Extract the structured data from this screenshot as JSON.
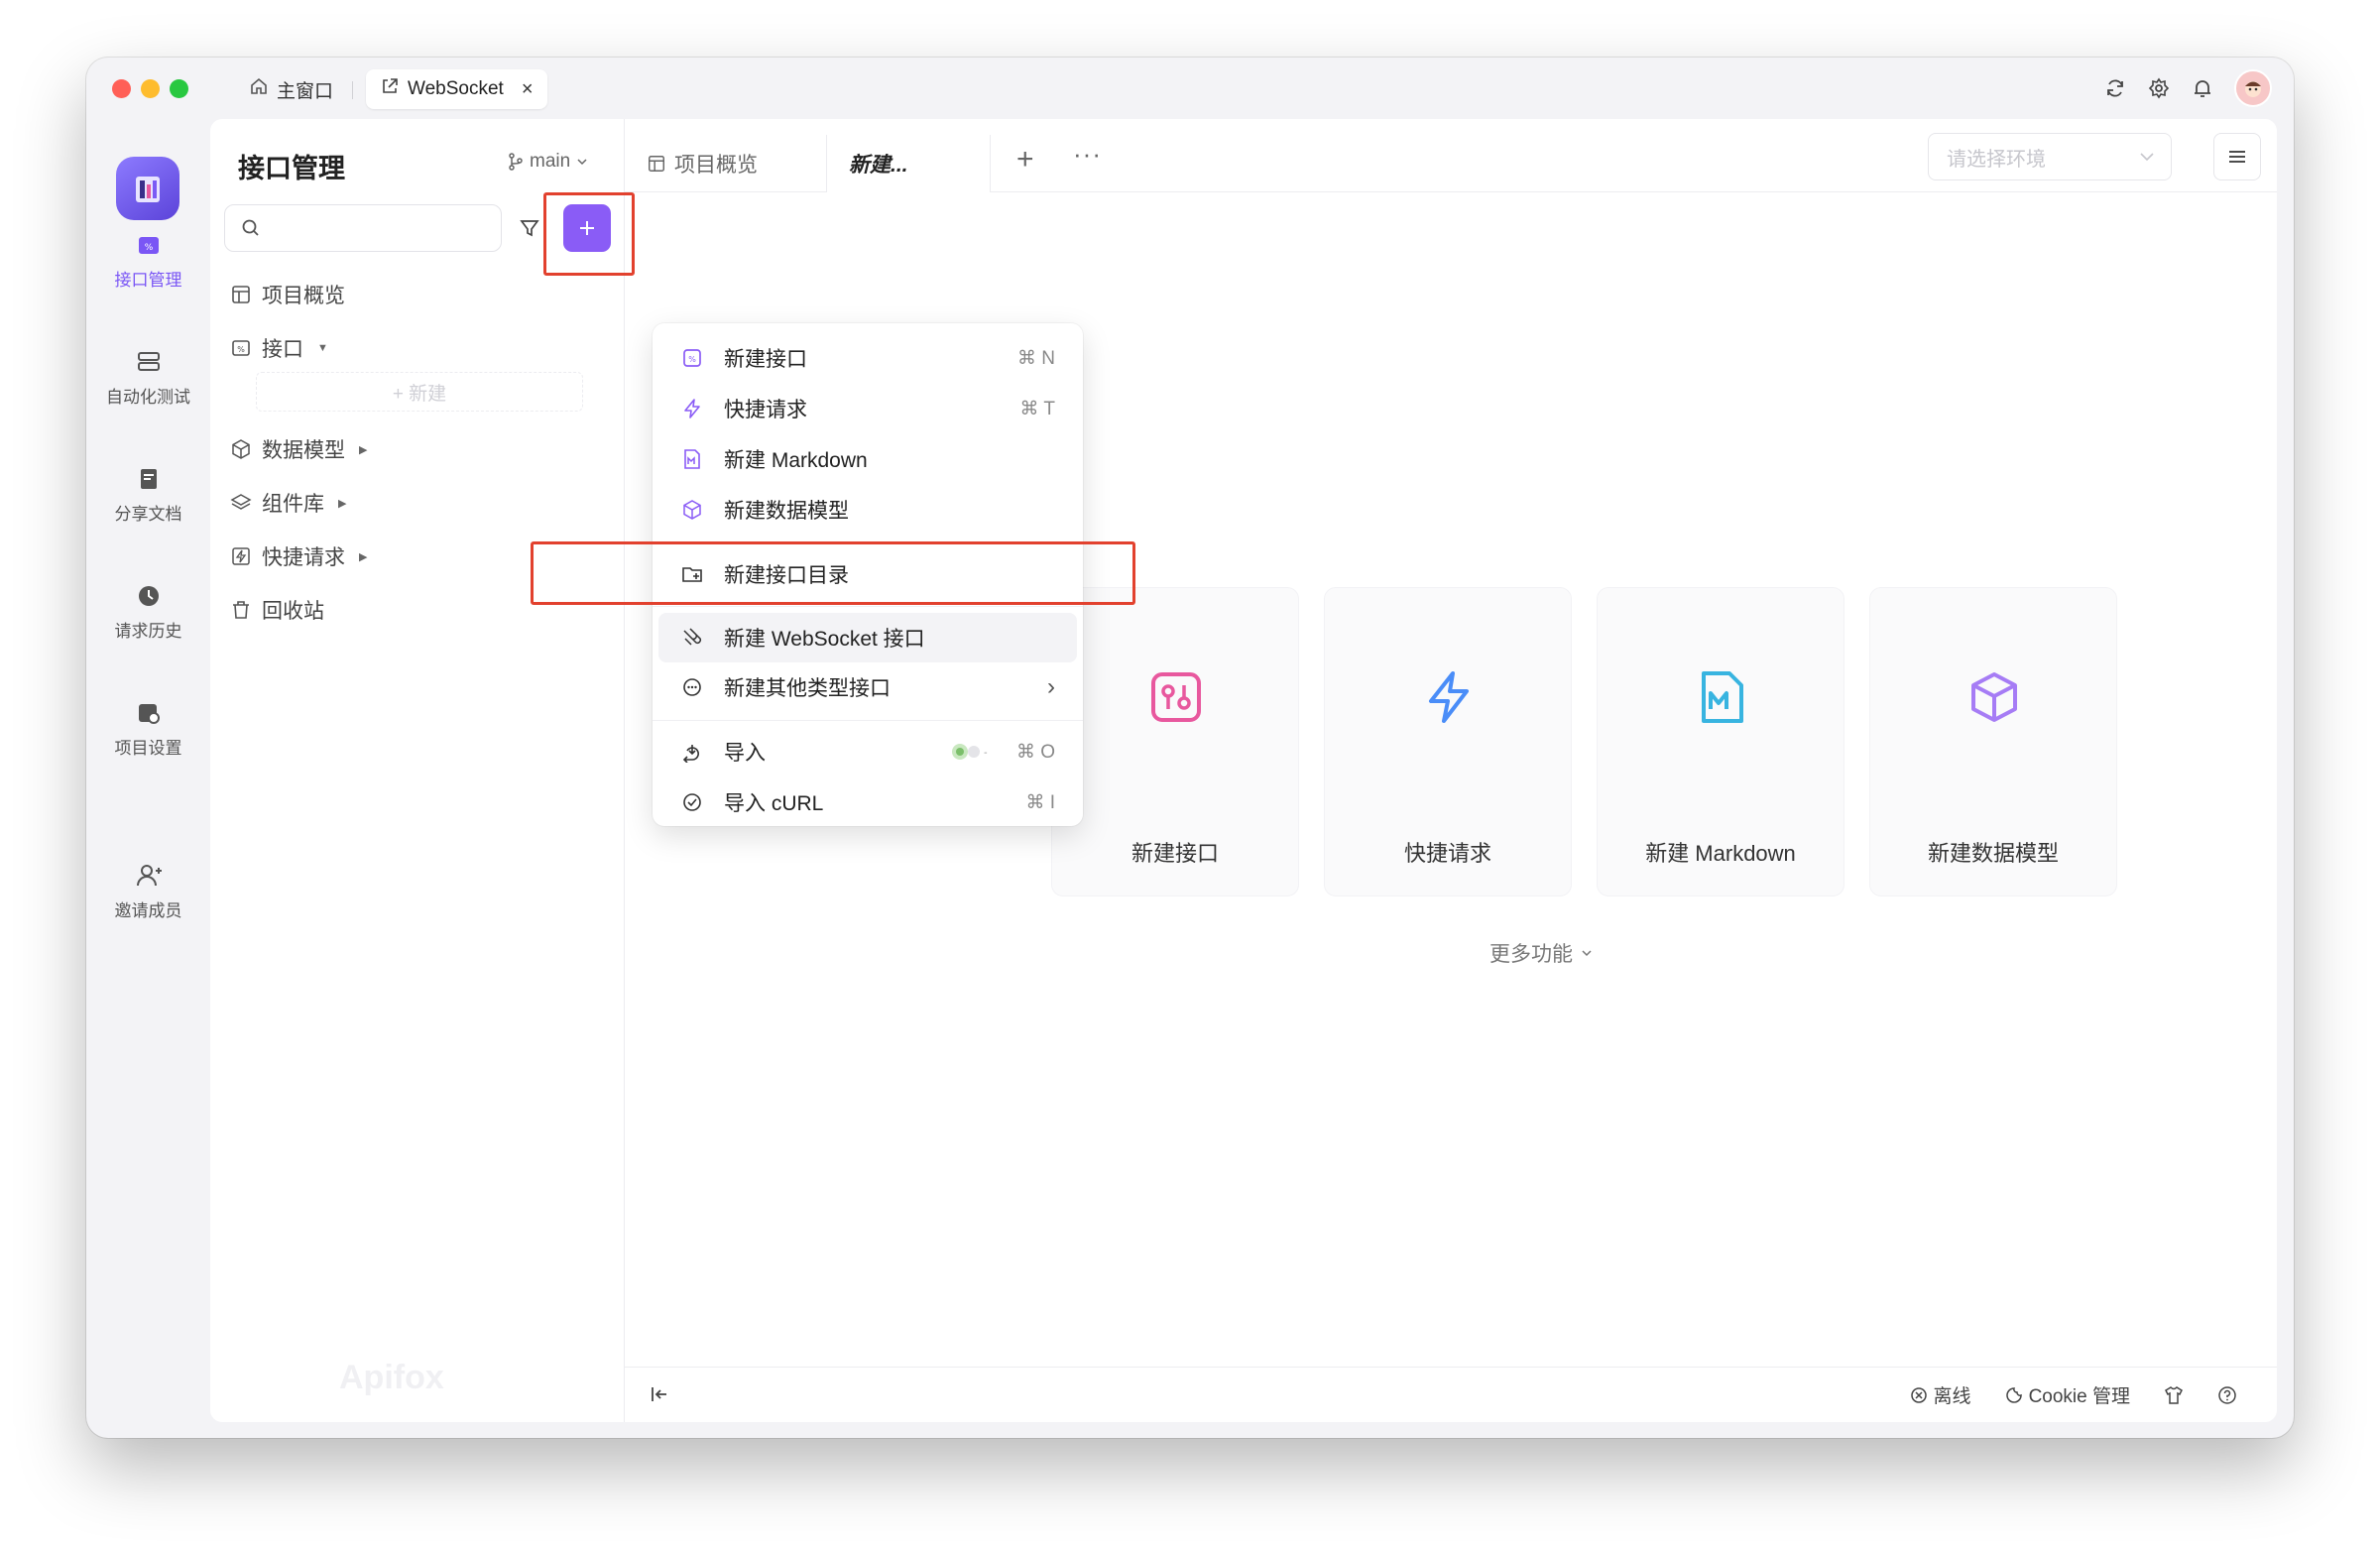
{
  "window_tabs": {
    "home": "主窗口",
    "websocket": "WebSocket",
    "close": "×"
  },
  "rail": {
    "items": [
      {
        "label": "接口管理",
        "active": true
      },
      {
        "label": "自动化测试"
      },
      {
        "label": "分享文档"
      },
      {
        "label": "请求历史"
      },
      {
        "label": "项目设置"
      },
      {
        "label": "邀请成员"
      }
    ]
  },
  "sidebar": {
    "title": "接口管理",
    "branch": "main",
    "search_placeholder": "",
    "tree": [
      {
        "label": "项目概览"
      },
      {
        "label": "接口"
      },
      {
        "label": "数据模型"
      },
      {
        "label": "组件库"
      },
      {
        "label": "快捷请求"
      },
      {
        "label": "回收站"
      }
    ],
    "new_inline": "+ 新建",
    "watermark": "Apifox"
  },
  "tabs": {
    "overview": "项目概览",
    "new": "新建...",
    "plus": "+",
    "more": "···",
    "env_placeholder": "请选择环境"
  },
  "dropdown": {
    "items": [
      {
        "label": "新建接口",
        "shortcut": "⌘ N"
      },
      {
        "label": "快捷请求",
        "shortcut": "⌘ T"
      },
      {
        "label": "新建 Markdown",
        "shortcut": ""
      },
      {
        "label": "新建数据模型",
        "shortcut": ""
      },
      {
        "label": "新建接口目录",
        "shortcut": ""
      },
      {
        "label": "新建 WebSocket 接口",
        "shortcut": ""
      },
      {
        "label": "新建其他类型接口",
        "shortcut": "›"
      },
      {
        "label": "导入",
        "shortcut": "⌘ O"
      },
      {
        "label": "导入 cURL",
        "shortcut": "⌘ I"
      }
    ]
  },
  "cards": [
    {
      "label": "新建接口",
      "color": "#e8589e"
    },
    {
      "label": "快捷请求",
      "color": "#4a8df8"
    },
    {
      "label": "新建 Markdown",
      "color": "#38b4e0"
    },
    {
      "label": "新建数据模型",
      "color": "#a67cf5"
    }
  ],
  "more_functions": "更多功能",
  "footer": {
    "offline": "离线",
    "cookie": "Cookie 管理"
  },
  "colors": {
    "accent": "#8a5cf6",
    "highlight": "#e2412e"
  }
}
